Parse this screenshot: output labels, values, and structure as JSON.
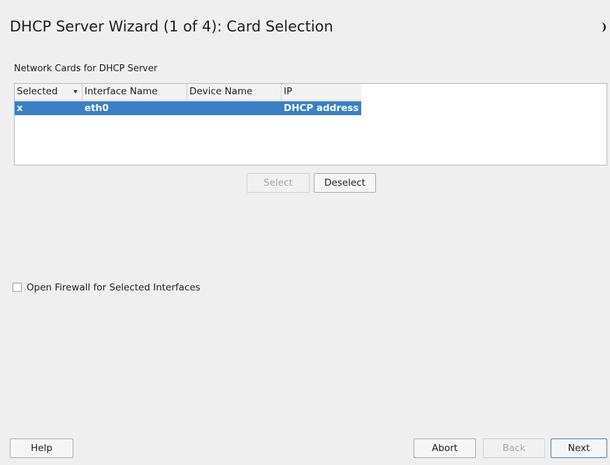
{
  "window": {
    "title": "DHCP Server Wizard (1 of 4): Card Selection"
  },
  "cards": {
    "label": "Network Cards for DHCP Server",
    "columns": [
      "Selected",
      "Interface Name",
      "Device Name",
      "IP"
    ],
    "rows": [
      {
        "selected": "x",
        "interface": "eth0",
        "device": "",
        "ip": "DHCP address"
      }
    ],
    "select_button": "Select",
    "deselect_button": "Deselect"
  },
  "firewall": {
    "label": "Open Firewall for Selected Interfaces",
    "checked": false
  },
  "footer": {
    "help": "Help",
    "abort": "Abort",
    "back": "Back",
    "next": "Next"
  },
  "colors": {
    "selection": "#3c7fc4",
    "background": "#efefef"
  },
  "icons": {
    "corner": "half-moon-icon",
    "sort": "sort-descending-icon"
  }
}
